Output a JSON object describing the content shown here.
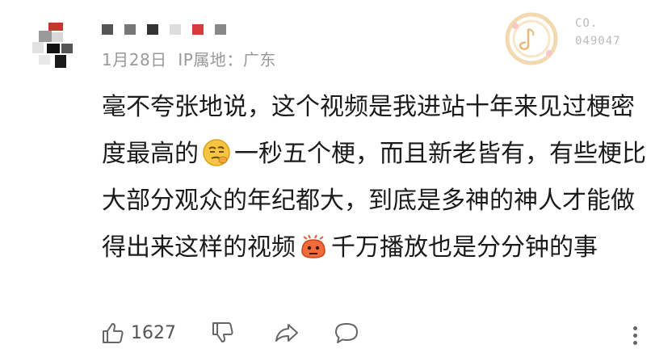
{
  "comment": {
    "date": "1月28日",
    "ip_location": "IP属地：广东",
    "badge": {
      "line1": "CO.",
      "line2": "049047"
    },
    "content": {
      "part1": "毫不夸张地说，这个视频是我进站十年来见过梗密度最高的",
      "emoji1": "smirk-face-icon",
      "part2": "一秒五个梗，而且新老皆有，有些梗比大部分观众的年纪都大，到底是多神的神人才能做得出来这样的视频",
      "emoji2": "angry-face-icon",
      "part3": "千万播放也是分分钟的事"
    },
    "actions": {
      "like_count": "1627",
      "like_icon": "thumbs-up-icon",
      "dislike_icon": "thumbs-down-icon",
      "share_icon": "share-icon",
      "reply_icon": "comment-icon",
      "more_icon": "more-vertical-icon"
    }
  },
  "colors": {
    "meta_text": "#999999",
    "body_text": "#1b1b1b",
    "icon": "#666666",
    "avatar_red": "#c0392b"
  }
}
